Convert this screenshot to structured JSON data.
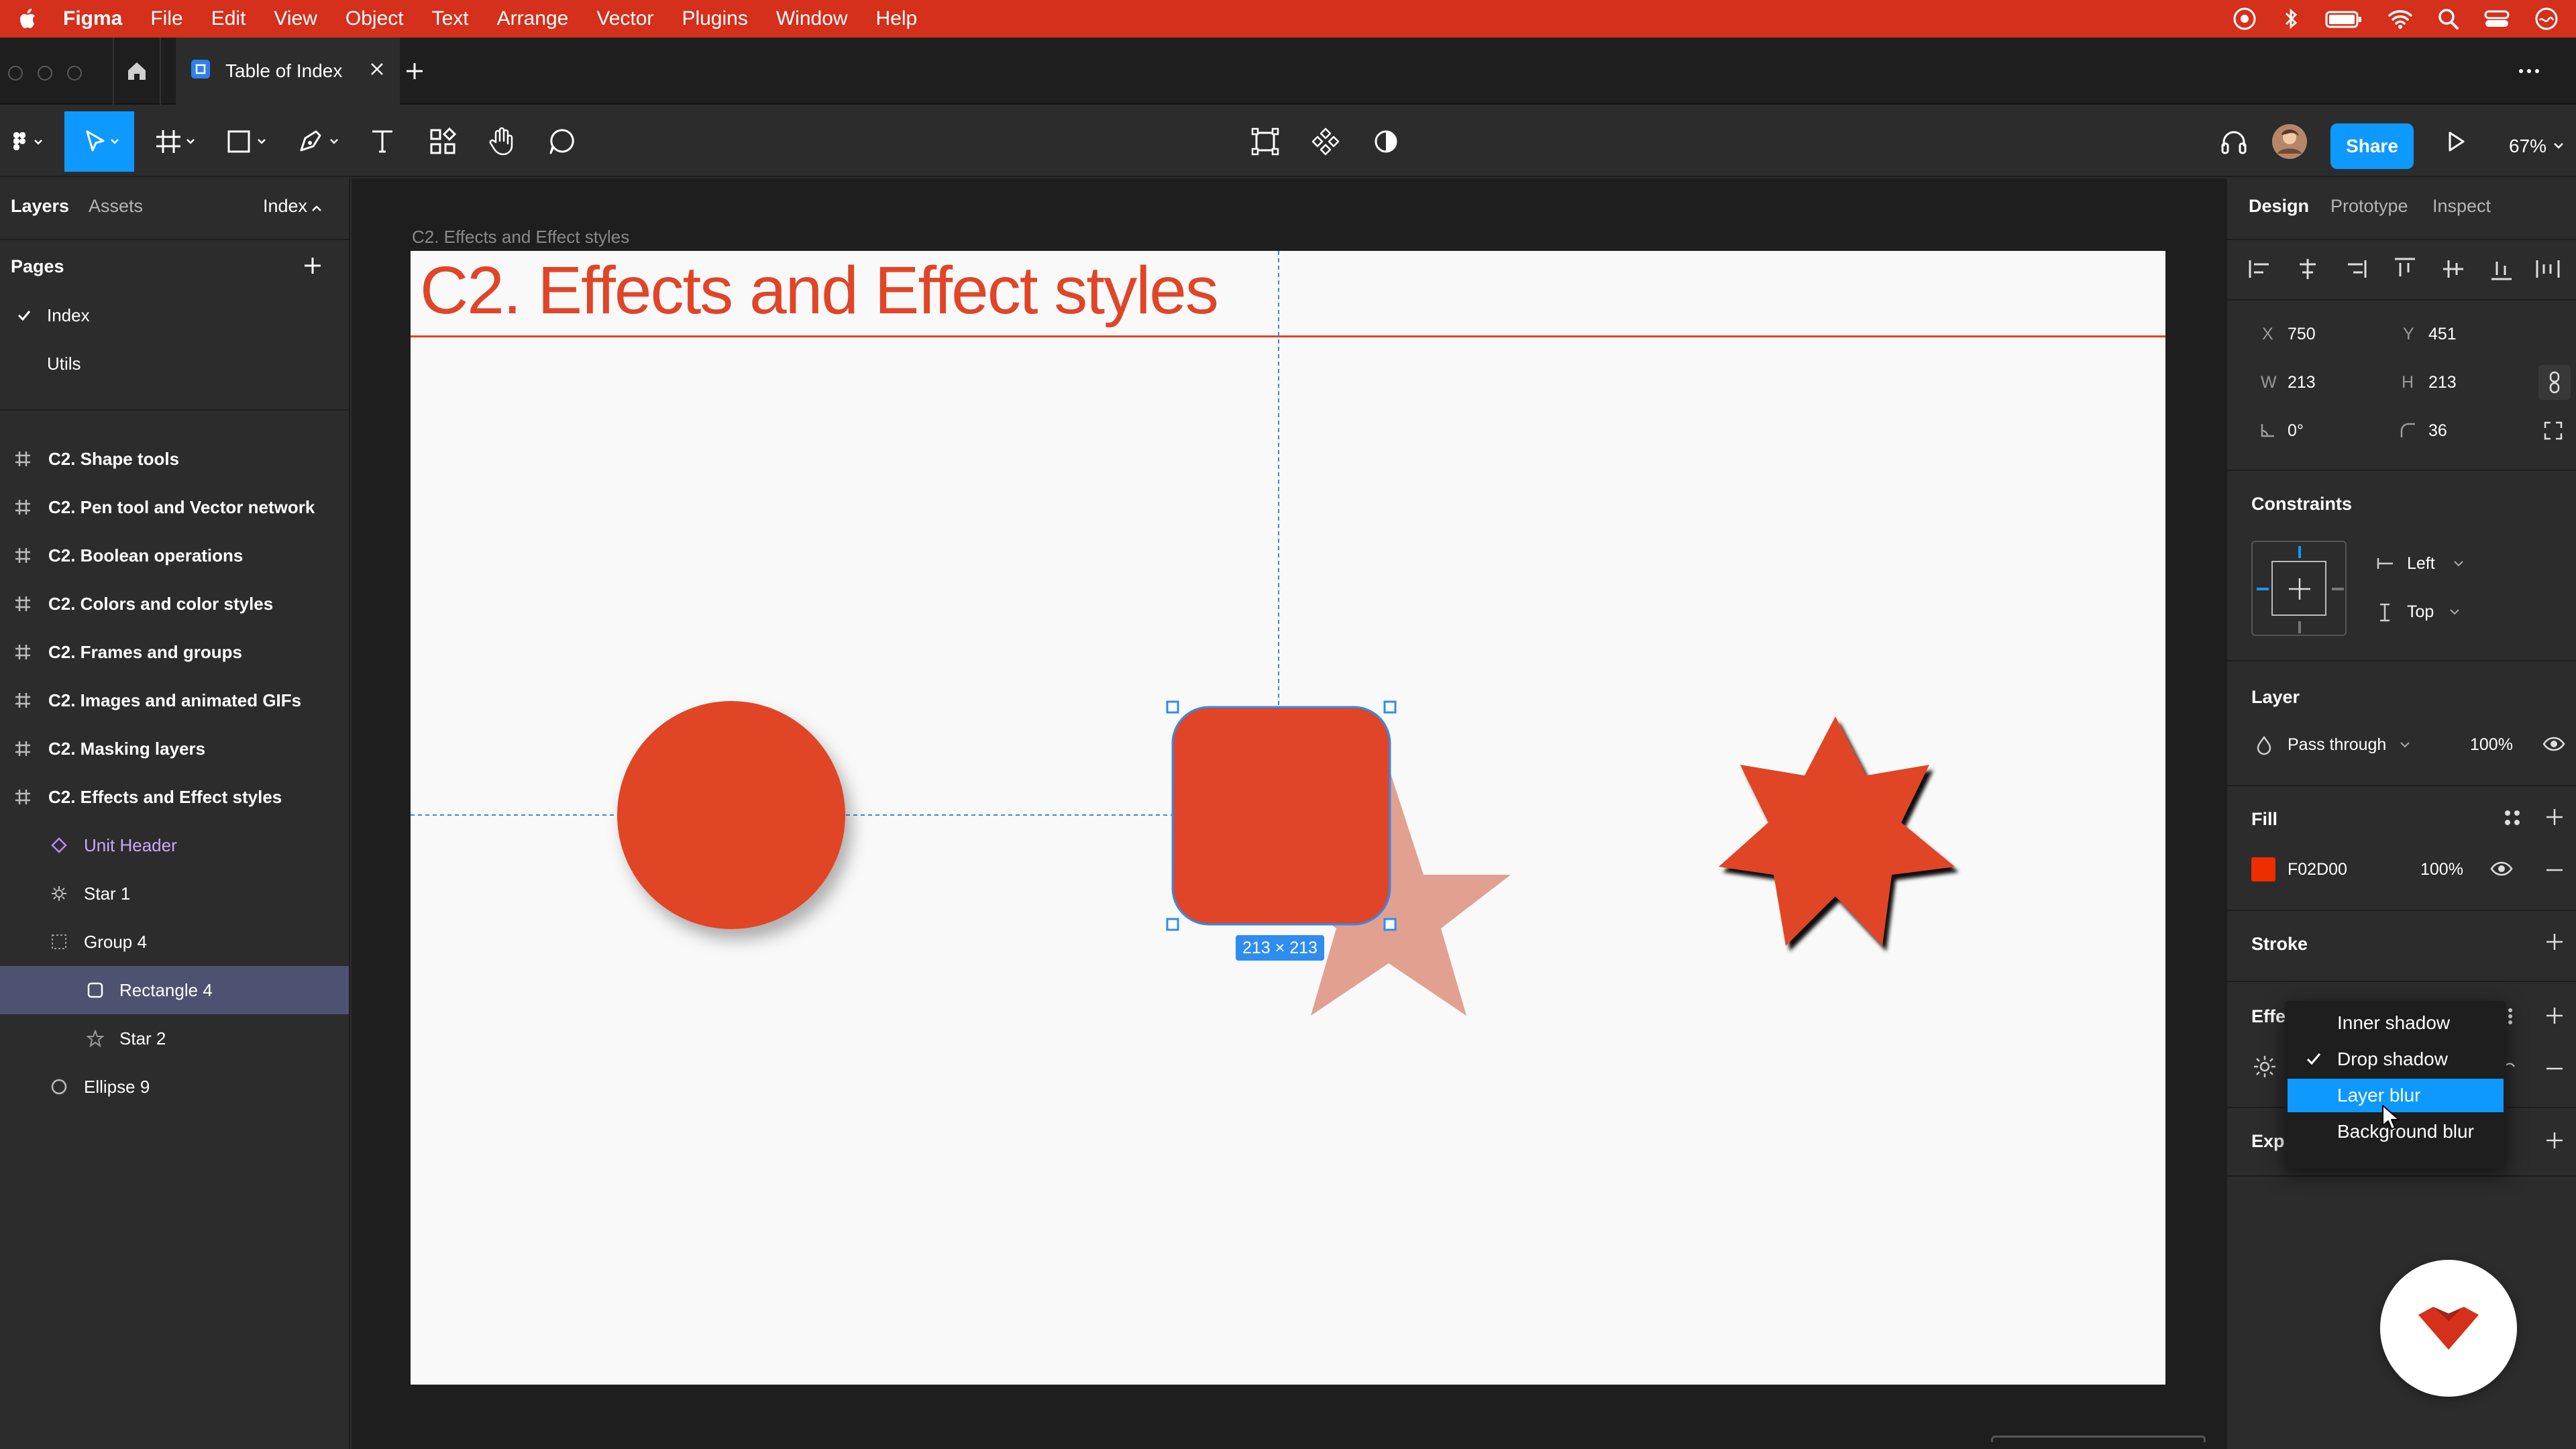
{
  "menubar": {
    "app": "Figma",
    "items": [
      "File",
      "Edit",
      "View",
      "Object",
      "Text",
      "Arrange",
      "Vector",
      "Plugins",
      "Window",
      "Help"
    ]
  },
  "tabbar": {
    "tab_title": "Table of Index"
  },
  "toolbar": {
    "share_label": "Share",
    "zoom": "67%"
  },
  "left": {
    "tabs": {
      "layers": "Layers",
      "assets": "Assets",
      "page_switch": "Index"
    },
    "pages_title": "Pages",
    "pages": [
      "Index",
      "Utils"
    ],
    "frames": [
      "C2. Shape tools",
      "C2. Pen tool and Vector network",
      "C2. Boolean operations",
      "C2. Colors and color styles",
      "C2. Frames and groups",
      "C2. Images and animated GIFs",
      "C2. Masking layers",
      "C2. Effects and Effect styles"
    ],
    "children": [
      "Unit Header",
      "Star 1",
      "Group 4",
      "Rectangle 4",
      "Star 2",
      "Ellipse 9"
    ]
  },
  "canvas": {
    "frame_label": "C2. Effects and Effect styles",
    "heading": "C2.  Effects and Effect styles",
    "size_badge": "213 × 213"
  },
  "right": {
    "tabs": {
      "design": "Design",
      "prototype": "Prototype",
      "inspect": "Inspect"
    },
    "x_label": "X",
    "x": "750",
    "y_label": "Y",
    "y": "451",
    "w_label": "W",
    "w": "213",
    "h_label": "H",
    "h": "213",
    "rotation": "0°",
    "radius": "36",
    "constraints_title": "Constraints",
    "constraint_h": "Left",
    "constraint_v": "Top",
    "layer_title": "Layer",
    "blend_mode": "Pass through",
    "layer_opacity": "100%",
    "fill_title": "Fill",
    "fill_hex": "F02D00",
    "fill_opacity": "100%",
    "fill_color": "#f02d00",
    "stroke_title": "Stroke",
    "effects_title_partial": "Effec",
    "export_title_partial": "Expo"
  },
  "effect_menu": {
    "options": [
      "Inner shadow",
      "Drop shadow",
      "Layer blur",
      "Background blur"
    ],
    "checked": "Drop shadow",
    "highlighted": "Layer blur"
  },
  "colors": {
    "accent": "#0d99ff",
    "brand_red": "#e04528",
    "menubar_red": "#d4301c"
  }
}
